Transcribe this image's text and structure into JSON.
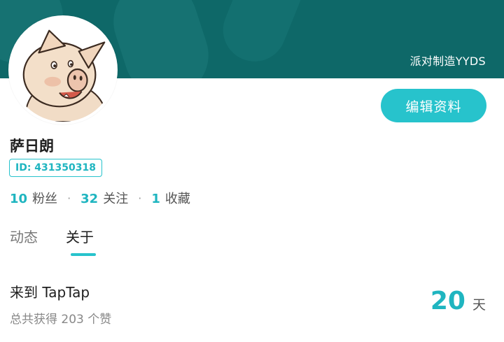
{
  "banner": {
    "tag": "派对制造YYDS"
  },
  "profile": {
    "username": "萨日朗",
    "id_label": "ID: 431350318",
    "edit_button": "编辑资料"
  },
  "stats": [
    {
      "value": "10",
      "label": "粉丝"
    },
    {
      "value": "32",
      "label": "关注"
    },
    {
      "value": "1",
      "label": "收藏"
    }
  ],
  "stat_separator": "·",
  "tabs": [
    {
      "label": "动态",
      "active": false
    },
    {
      "label": "关于",
      "active": true
    }
  ],
  "about": {
    "join_title": "来到 TapTap",
    "likes_text": "总共获得 203 个赞",
    "days_value": "20",
    "days_unit": "天"
  },
  "colors": {
    "banner": "#0e6868",
    "accent": "#27c3cc",
    "accent_text": "#1fb5c0"
  },
  "icons": {
    "avatar": "pig-avatar-icon"
  }
}
